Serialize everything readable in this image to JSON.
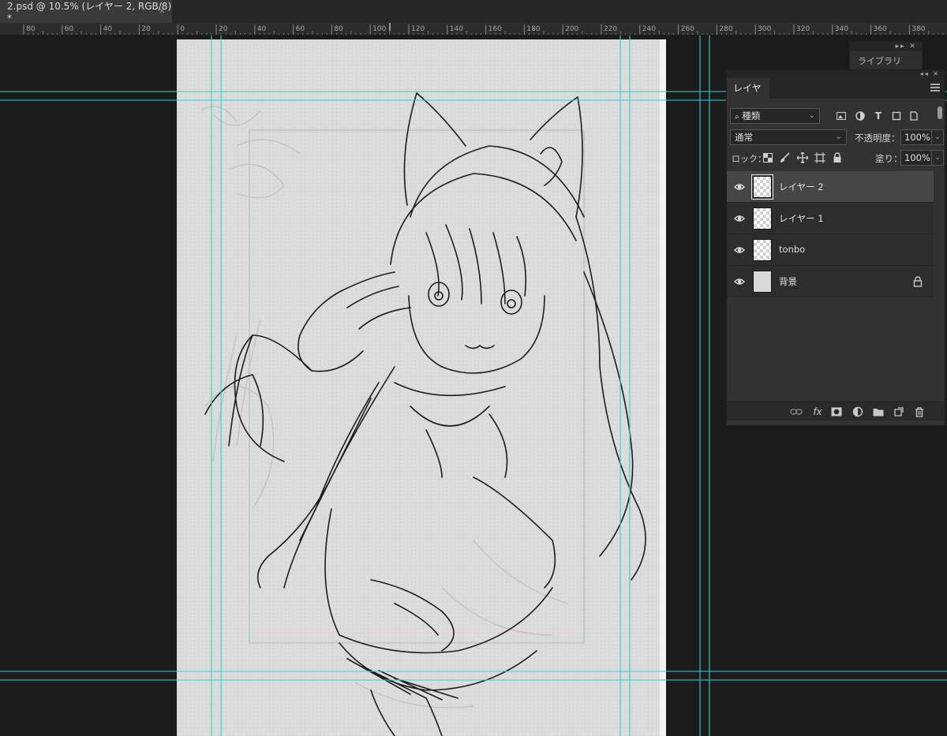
{
  "document_tab": {
    "title": "2.psd @ 10.5% (レイヤー 2, RGB/8) *",
    "close": "×"
  },
  "ruler": {
    "labels": [
      "80",
      "60",
      "40",
      "20",
      "0",
      "20",
      "40",
      "60",
      "80",
      "100",
      "120",
      "140",
      "160",
      "180",
      "200",
      "220",
      "240",
      "260",
      "280",
      "300",
      "320",
      "340",
      "360",
      "380"
    ]
  },
  "mini_panel": {
    "collapse": "▸▸ ✕",
    "label": "ライブラリ"
  },
  "layers_panel": {
    "collapse": "◂◂ ✕",
    "tab_label": "レイヤー",
    "filter": {
      "kind_label": "種類",
      "icons": [
        "image-filter-icon",
        "adjustment-filter-icon",
        "type-filter-icon",
        "shape-filter-icon",
        "smart-object-filter-icon"
      ]
    },
    "blend_mode": "通常",
    "opacity_label": "不透明度：",
    "opacity_value": "100%",
    "lock_label": "ロック：",
    "fill_label": "塗り：",
    "fill_value": "100%",
    "layers": [
      {
        "name": "レイヤー 2",
        "visible": true,
        "selected": true,
        "locked": false
      },
      {
        "name": "レイヤー 1",
        "visible": true,
        "selected": false,
        "locked": false
      },
      {
        "name": "tonbo",
        "visible": true,
        "selected": false,
        "locked": false
      },
      {
        "name": "背景",
        "visible": true,
        "selected": false,
        "locked": true
      }
    ],
    "footer_fx": "fx"
  },
  "colors": {
    "guide": "#2fd3d6",
    "panel_bg": "#323232",
    "app_bg": "#1b1b1b",
    "selected_row": "#464646"
  }
}
